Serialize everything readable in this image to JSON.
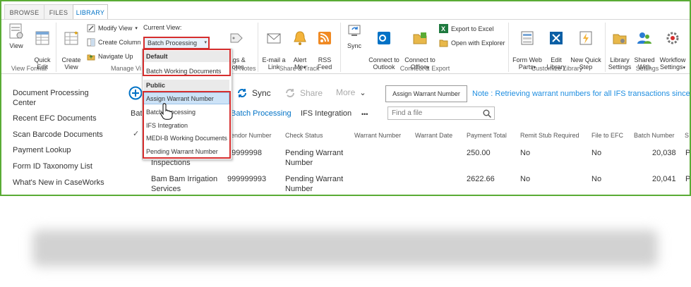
{
  "tabs": [
    "BROWSE",
    "FILES",
    "LIBRARY"
  ],
  "ribbon": {
    "view": "View",
    "quick_edit": "Quick\nEdit",
    "view_format": "View Format",
    "create_view": "Create\nView",
    "modify_view": "Modify View",
    "create_column": "Create Column",
    "navigate_up": "Navigate Up",
    "current_view_label": "Current View:",
    "current_view_value": "Batch Processing",
    "manage_views": "Manage Vi",
    "tags_notes": "Tags &\nNotes",
    "tags_group": "d Notes",
    "email_link": "E-mail a\nLink",
    "alert_me": "Alert\nMe",
    "rss_feed": "RSS\nFeed",
    "share_track": "Share & Track",
    "sync": "Sync",
    "connect_outlook": "Connect to\nOutlook",
    "connect_office": "Connect to\nOffice",
    "export_excel": "Export to Excel",
    "open_explorer": "Open with Explorer",
    "connect_export": "Connect & Export",
    "form_web_parts": "Form Web\nParts",
    "edit_library": "Edit\nLibrary",
    "new_quick_step": "New Quick\nStep",
    "customize_library": "Customize Library",
    "library_settings": "Library\nSettings",
    "shared_with": "Shared\nWith",
    "workflow_settings": "Workflow\nSettings",
    "settings": "Settings"
  },
  "dropdown": {
    "default_header": "Default",
    "default_items": [
      "Batch Working Documents"
    ],
    "public_header": "Public",
    "public_items": [
      "Assign Warrant Number",
      "Batch Processing",
      "IFS Integration",
      "MEDI-B Working Documents",
      "Pending Warrant Number"
    ]
  },
  "nav": [
    "Document Processing\nCenter",
    "Recent EFC Documents",
    "Scan Barcode Documents",
    "Payment Lookup",
    "Form ID Taxonomy List",
    "What's New in CaseWorks"
  ],
  "commands": {
    "sync": "Sync",
    "share": "Share",
    "more": "More",
    "assign_button": "Assign Warrant Number",
    "note": "Note : Retrieving warrant numbers for all IFS transactions since 01"
  },
  "views": {
    "batch_partial": "Batc",
    "batch_processing": "Batch Processing",
    "ifs_integration": "IFS Integration",
    "more_dots": "•••",
    "find_placeholder": "Find a file"
  },
  "columns": [
    "endor Number",
    "Check Status",
    "Warrant Number",
    "Warrant Date",
    "Payment Total",
    "Remit Stub Required",
    "File to EFC",
    "Batch Number",
    "S"
  ],
  "rows": [
    {
      "vendor_name": "Inspections",
      "vendor_number": "99999998",
      "check_status": "Pending Warrant\nNumber",
      "payment_total": "250.00",
      "remit_stub": "No",
      "file_efc": "No",
      "batch_number": "20,038",
      "s": "P"
    },
    {
      "vendor_name": "Bam Bam Irrigation\nServices",
      "vendor_number": "999999993",
      "check_status": "Pending Warrant\nNumber",
      "payment_total": "2622.66",
      "remit_stub": "No",
      "file_efc": "No",
      "batch_number": "20,041",
      "s": "P"
    }
  ],
  "colors": {
    "frame": "#5aab35",
    "accent": "#0072c6",
    "highlight_red": "#d62e2e",
    "note_blue": "#1f8ee0"
  }
}
